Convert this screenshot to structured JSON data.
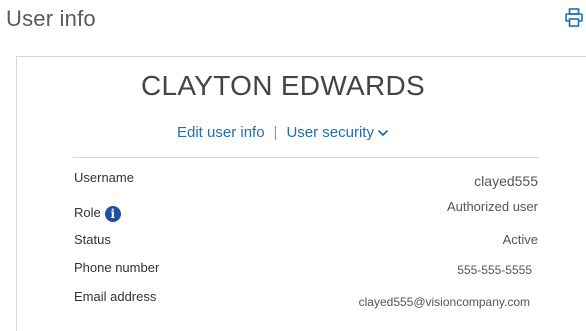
{
  "page": {
    "title": "User info"
  },
  "user": {
    "name": "CLAYTON EDWARDS"
  },
  "links": {
    "edit": "Edit user info",
    "separator": "|",
    "security": "User security"
  },
  "fields": {
    "username": {
      "label": "Username",
      "value": "clayed555"
    },
    "role": {
      "label": "Role",
      "value": "Authorized user"
    },
    "status": {
      "label": "Status",
      "value": "Active"
    },
    "phone": {
      "label": "Phone number",
      "value": "555-555-5555"
    },
    "email": {
      "label": "Email address",
      "value": "clayed555@visioncompany.com"
    }
  },
  "icons": {
    "print": "printer-icon",
    "role_info": "info-icon",
    "security_menu": "chevron-down-icon"
  },
  "colors": {
    "link": "#1f6fb6",
    "info_icon": "#1f4fa0",
    "title_text": "#5a5a5a",
    "border": "#d6d6d6"
  }
}
